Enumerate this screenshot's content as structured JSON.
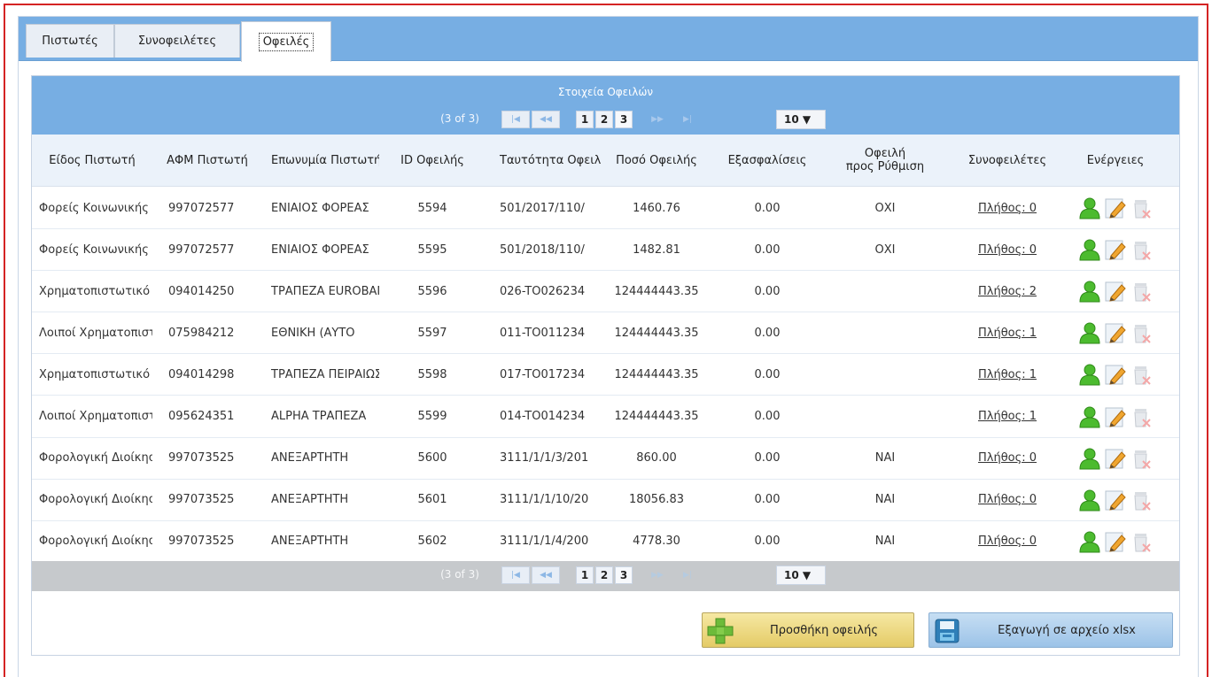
{
  "tabs": [
    {
      "label": "Πιστωτές",
      "active": false
    },
    {
      "label": "Συνοφειλέτες",
      "active": false
    },
    {
      "label": "Οφειλές",
      "active": true
    }
  ],
  "panel": {
    "title": "Στοιχεία Οφειλών"
  },
  "pager": {
    "count": "(3 of 3)",
    "first_icon": "first-page-icon",
    "prev_icon": "prev-page-icon",
    "next_icon": "next-page-icon",
    "last_icon": "last-page-icon",
    "pages": [
      "1",
      "2",
      "3"
    ],
    "current_page": "3",
    "rows_per_page": "10 ▼"
  },
  "columns": [
    "Είδος Πιστωτή",
    "ΑΦΜ Πιστωτή",
    "Επωνυμία Πιστωτή",
    "ID Οφειλής",
    "Ταυτότητα Οφειλής",
    "Ποσό Οφειλής",
    "Εξασφαλίσεις",
    "Οφειλή\nπρος Ρύθμιση",
    "Συνοφειλέτες",
    "Ενέργειες"
  ],
  "rows": [
    {
      "type": "Φορείς Κοινωνικής",
      "afm": "997072577",
      "name": "ΕΝΙΑΙΟΣ ΦΟΡΕΑΣ",
      "id": "5594",
      "identity": "501/2017/110/",
      "amount": "1460.76",
      "collateral": "0.00",
      "settle": "ΟΧΙ",
      "codebtors": "Πλήθος: 0"
    },
    {
      "type": "Φορείς Κοινωνικής",
      "afm": "997072577",
      "name": "ΕΝΙΑΙΟΣ ΦΟΡΕΑΣ",
      "id": "5595",
      "identity": "501/2018/110/",
      "amount": "1482.81",
      "collateral": "0.00",
      "settle": "ΟΧΙ",
      "codebtors": "Πλήθος: 0"
    },
    {
      "type": "Χρηματοπιστωτικό",
      "afm": "094014250",
      "name": "ΤΡΑΠΕΖΑ EUROBANK",
      "id": "5596",
      "identity": "026-TO026234",
      "amount": "124444443.35",
      "collateral": "0.00",
      "settle": "",
      "codebtors": "Πλήθος: 2"
    },
    {
      "type": "Λοιποί Χρηματοπιστωτικοί",
      "afm": "075984212",
      "name": "ΕΘΝΙΚΗ (ΑΥΤΟ",
      "id": "5597",
      "identity": "011-TO011234",
      "amount": "124444443.35",
      "collateral": "0.00",
      "settle": "",
      "codebtors": "Πλήθος: 1"
    },
    {
      "type": "Χρηματοπιστωτικό",
      "afm": "094014298",
      "name": "ΤΡΑΠΕΖΑ ΠΕΙΡΑΙΩΣ",
      "id": "5598",
      "identity": "017-TO017234",
      "amount": "124444443.35",
      "collateral": "0.00",
      "settle": "",
      "codebtors": "Πλήθος: 1"
    },
    {
      "type": "Λοιποί Χρηματοπιστωτικοί",
      "afm": "095624351",
      "name": "ALPHA ΤΡΑΠΕΖΑ",
      "id": "5599",
      "identity": "014-TO014234",
      "amount": "124444443.35",
      "collateral": "0.00",
      "settle": "",
      "codebtors": "Πλήθος: 1"
    },
    {
      "type": "Φορολογική Διοίκηση",
      "afm": "997073525",
      "name": "ΑΝΕΞΑΡΤΗΤΗ",
      "id": "5600",
      "identity": "3111/1/1/3/201",
      "amount": "860.00",
      "collateral": "0.00",
      "settle": "ΝΑΙ",
      "codebtors": "Πλήθος: 0"
    },
    {
      "type": "Φορολογική Διοίκηση",
      "afm": "997073525",
      "name": "ΑΝΕΞΑΡΤΗΤΗ",
      "id": "5601",
      "identity": "3111/1/1/10/20",
      "amount": "18056.83",
      "collateral": "0.00",
      "settle": "ΝΑΙ",
      "codebtors": "Πλήθος: 0"
    },
    {
      "type": "Φορολογική Διοίκηση",
      "afm": "997073525",
      "name": "ΑΝΕΞΑΡΤΗΤΗ",
      "id": "5602",
      "identity": "3111/1/1/4/200",
      "amount": "4778.30",
      "collateral": "0.00",
      "settle": "ΝΑΙ",
      "codebtors": "Πλήθος: 0"
    }
  ],
  "actions": {
    "codebtor_icon": "user-icon",
    "edit_icon": "edit-pencil-icon",
    "delete_icon": "delete-trash-icon"
  },
  "buttons": {
    "add_label": "Προσθήκη οφειλής",
    "export_label": "Εξαγωγή σε αρχείο xlsx"
  },
  "colors": {
    "header_blue": "#77aee3",
    "footer_gray": "#c6c9cc",
    "frame_red": "#d42424"
  }
}
